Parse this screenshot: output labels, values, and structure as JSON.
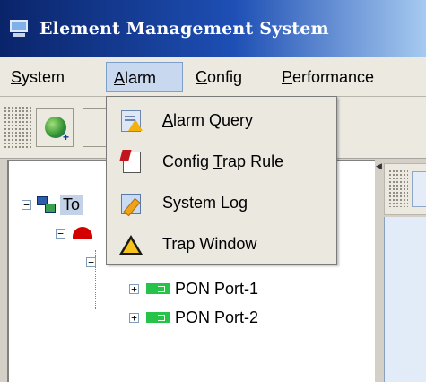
{
  "window": {
    "title": "Element Management System",
    "icon": "monitor-icon"
  },
  "menubar": {
    "items": [
      {
        "label": "System",
        "mnemonic": "S",
        "rest": "ystem"
      },
      {
        "label": "Alarm",
        "mnemonic": "A",
        "rest": "larm",
        "active": true
      },
      {
        "label": "Config",
        "mnemonic": "C",
        "rest": "onfig"
      },
      {
        "label": "Performance",
        "mnemonic": "P",
        "rest": "erformance"
      }
    ]
  },
  "toolbar": {
    "buttons": [
      {
        "icon": "globe-add-icon"
      },
      {
        "icon": "partial-button-icon"
      }
    ]
  },
  "alarm_menu": {
    "items": [
      {
        "label": "Alarm Query",
        "pre": "",
        "mnemonic": "A",
        "post": "larm Query",
        "icon": "alarm-query-icon"
      },
      {
        "label": "Config Trap Rule",
        "pre": "Config ",
        "mnemonic": "T",
        "post": "rap Rule",
        "icon": "trap-rule-icon"
      },
      {
        "label": "System Log",
        "pre": "System Log",
        "mnemonic": "",
        "post": "",
        "icon": "system-log-icon"
      },
      {
        "label": "Trap Window",
        "pre": "Trap Window",
        "mnemonic": "",
        "post": "",
        "icon": "warning-triangle-icon"
      }
    ]
  },
  "tree": {
    "root": {
      "label": "To",
      "expanded": true,
      "icon": "network-topology-icon"
    },
    "ports": [
      {
        "label": "PON Port-1"
      },
      {
        "label": "PON Port-2"
      }
    ]
  },
  "colors": {
    "titlebar_start": "#0a246a",
    "menu_highlight": "#c8d8ee",
    "port_icon": "#27c24a",
    "device_icon": "#d40000"
  }
}
